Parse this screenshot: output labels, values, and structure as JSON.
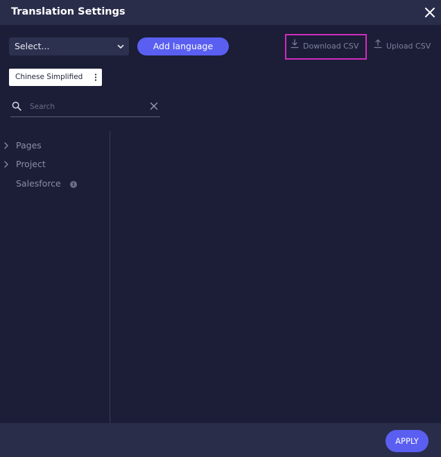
{
  "dialog": {
    "title": "Translation Settings"
  },
  "toolbar": {
    "select_value": "Select...",
    "add_language_label": "Add language",
    "download_csv_label": "Download CSV",
    "upload_csv_label": "Upload CSV"
  },
  "languages": [
    {
      "label": "Chinese Simplified"
    }
  ],
  "search": {
    "placeholder": "Search",
    "value": ""
  },
  "tree": {
    "items": [
      {
        "label": "Pages",
        "expandable": true
      },
      {
        "label": "Project",
        "expandable": true
      },
      {
        "label": "Salesforce",
        "expandable": false,
        "info": true
      }
    ]
  },
  "footer": {
    "apply_label": "APPLY"
  },
  "colors": {
    "background": "#1b1e36",
    "header_footer": "#2a2d4a",
    "accent": "#5a5ff2",
    "highlight": "#d42cbf",
    "muted_text": "#8b8ea6"
  }
}
